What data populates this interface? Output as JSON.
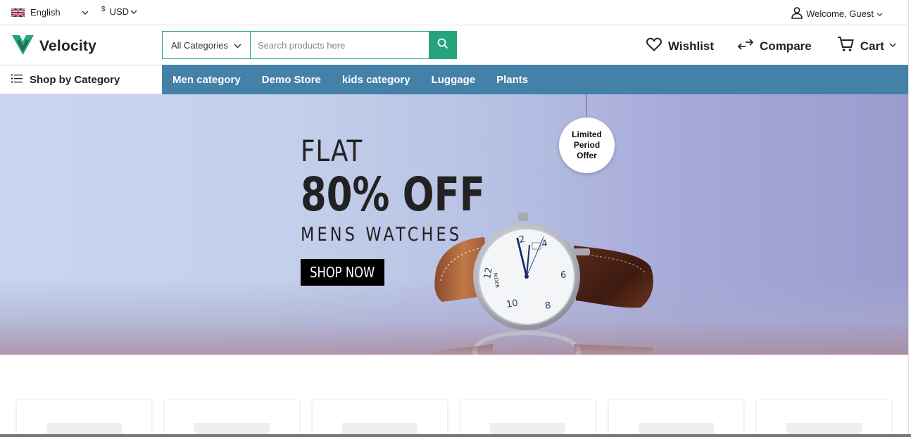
{
  "topbar": {
    "language": "English",
    "currency_symbol": "$",
    "currency": "USD",
    "welcome": "Welcome, Guest"
  },
  "header": {
    "logo_text": "Velocity",
    "brand_color": "#26a37c",
    "search": {
      "category": "All Categories",
      "placeholder": "Search products here"
    },
    "wishlist_label": "Wishlist",
    "compare_label": "Compare",
    "cart_label": "Cart"
  },
  "nav": {
    "shop_by_category": "Shop by Category",
    "bar_color": "#4381a8",
    "items": [
      {
        "label": "Men category"
      },
      {
        "label": "Demo Store"
      },
      {
        "label": "kids category"
      },
      {
        "label": "Luggage"
      },
      {
        "label": "Plants"
      }
    ]
  },
  "banner": {
    "line1": "FLAT",
    "line2": "80% OFF",
    "line3": "MENS WATCHES",
    "cta": "SHOP NOW",
    "badge": "Limited Period Offer",
    "watch_brand": "RIDER"
  }
}
